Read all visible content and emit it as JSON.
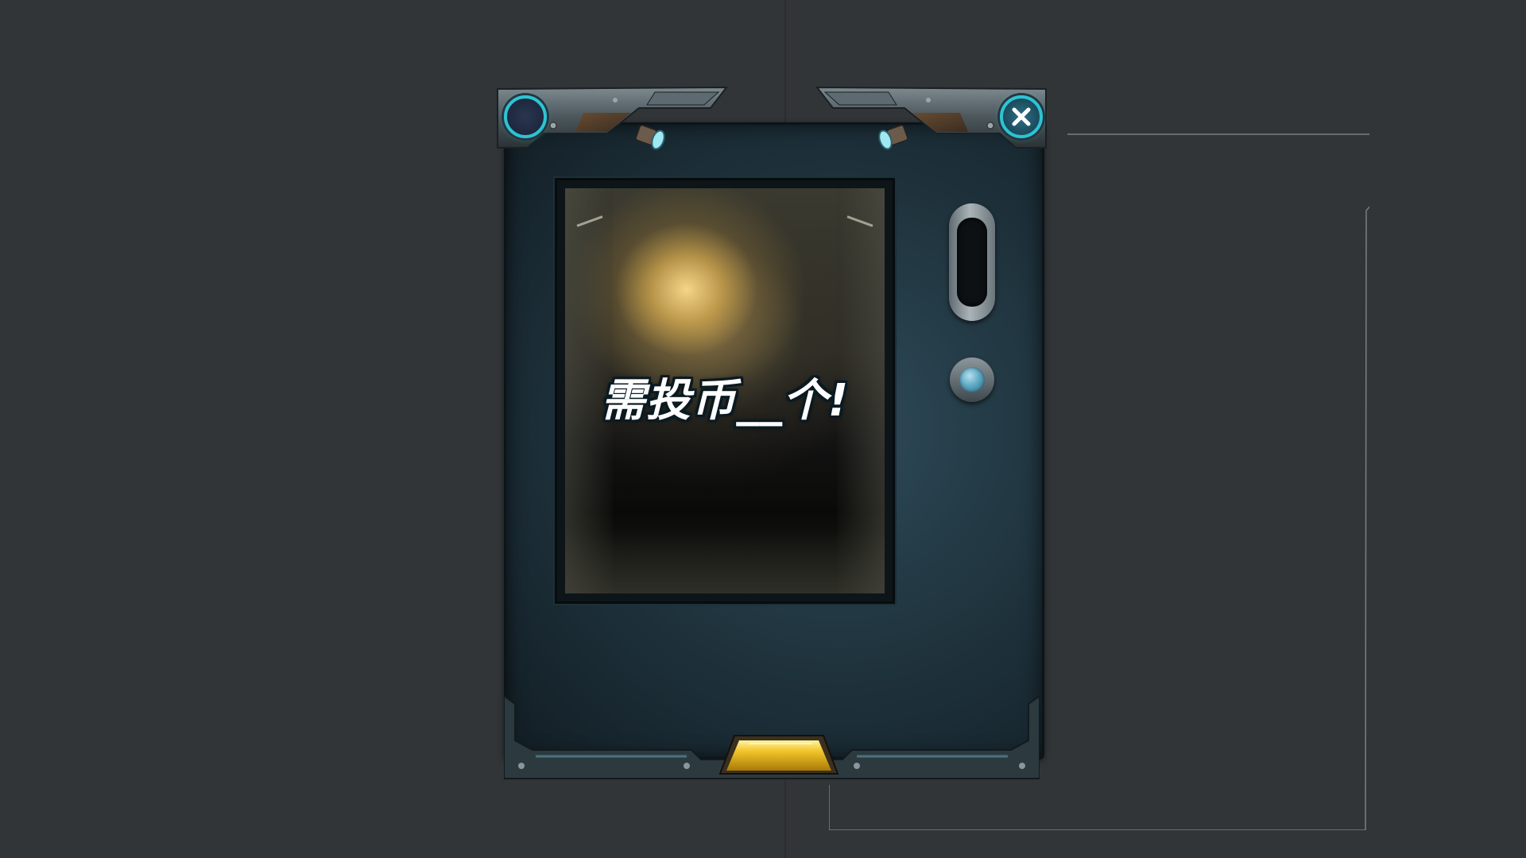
{
  "machine": {
    "screen_text": "需投币__个!"
  },
  "icons": {
    "left_button": "circle-button-icon",
    "close_button": "close-icon",
    "coin_slot": "coin-slot-icon",
    "push_button": "round-push-button-icon",
    "tray": "dispense-tray-icon",
    "lamp": "lamp-icon"
  },
  "colors": {
    "accent": "#2cc4d4",
    "panel": "#1f3540",
    "tray_gold": "#e8b81a",
    "background": "#323538"
  }
}
